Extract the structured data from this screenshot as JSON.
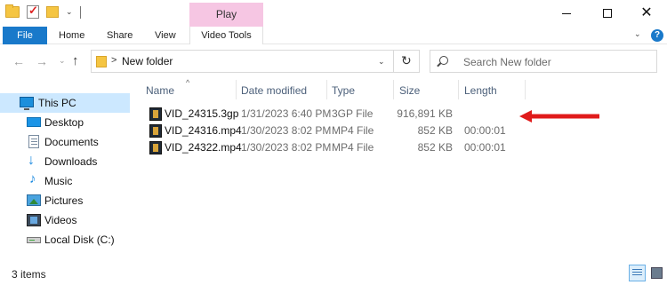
{
  "titlebar": {
    "context_tab": "Play",
    "minimize_icon": "minimize-icon",
    "maximize_icon": "maximize-icon",
    "close_icon": "close-icon",
    "close_glyph": "✕"
  },
  "ribbon": {
    "tabs": [
      {
        "label": "File"
      },
      {
        "label": "Home"
      },
      {
        "label": "Share"
      },
      {
        "label": "View"
      },
      {
        "label": "Video Tools"
      }
    ],
    "help_glyph": "?"
  },
  "address": {
    "path": "New folder",
    "back_glyph": "←",
    "forward_glyph": "→",
    "up_glyph": "↑",
    "refresh_glyph": "↻",
    "chevron_glyph": ">",
    "dropdown_glyph": "⌄"
  },
  "search": {
    "placeholder": "Search New folder"
  },
  "sidebar": {
    "items": [
      {
        "label": "This PC",
        "icon": "computer-icon"
      },
      {
        "label": "Desktop",
        "icon": "desktop-icon"
      },
      {
        "label": "Documents",
        "icon": "documents-icon"
      },
      {
        "label": "Downloads",
        "icon": "downloads-icon"
      },
      {
        "label": "Music",
        "icon": "music-icon"
      },
      {
        "label": "Pictures",
        "icon": "pictures-icon"
      },
      {
        "label": "Videos",
        "icon": "videos-icon"
      },
      {
        "label": "Local Disk (C:)",
        "icon": "disk-icon"
      }
    ],
    "downloads_glyph": "↓",
    "music_glyph": "♪"
  },
  "filelist": {
    "sort_indicator": "^",
    "columns": {
      "name": "Name",
      "date": "Date modified",
      "type": "Type",
      "size": "Size",
      "length": "Length"
    },
    "rows": [
      {
        "name": "VID_24315.3gp",
        "date": "1/31/2023 6:40 PM",
        "type": "3GP File",
        "size": "916,891 KB",
        "length": ""
      },
      {
        "name": "VID_24316.mp4",
        "date": "1/30/2023 8:02 PM",
        "type": "MP4 File",
        "size": "852 KB",
        "length": "00:00:01"
      },
      {
        "name": "VID_24322.mp4",
        "date": "1/30/2023 8:02 PM",
        "type": "MP4 File",
        "size": "852 KB",
        "length": "00:00:01"
      }
    ]
  },
  "status": {
    "item_count": "3 items"
  },
  "colors": {
    "accent": "#1979ca",
    "selection": "#cce8ff",
    "play_tab": "#f6c6e3",
    "annotation_arrow": "#e01b1b"
  }
}
